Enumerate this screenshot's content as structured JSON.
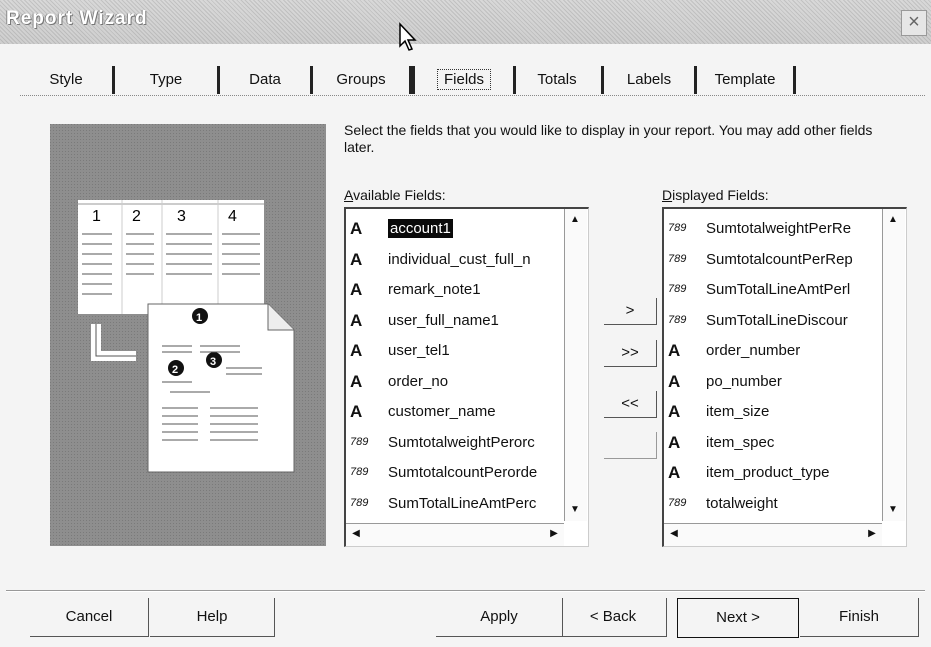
{
  "window": {
    "title": "Report Wizard",
    "close_glyph": "×"
  },
  "tabs": [
    {
      "label": "Style"
    },
    {
      "label": "Type"
    },
    {
      "label": "Data"
    },
    {
      "label": "Groups"
    },
    {
      "label": "Fields",
      "active": true
    },
    {
      "label": "Totals"
    },
    {
      "label": "Labels"
    },
    {
      "label": "Template"
    }
  ],
  "instructions": "Select the fields that you would like to display in your report. You may add other fields later.",
  "available": {
    "label_prefix": "A",
    "label_rest": "vailable Fields:",
    "items": [
      {
        "icon": "text-field-icon",
        "label": "account1",
        "selected": true
      },
      {
        "icon": "text-field-icon",
        "label": "individual_cust_full_n"
      },
      {
        "icon": "text-field-icon",
        "label": "remark_note1"
      },
      {
        "icon": "text-field-icon",
        "label": "user_full_name1"
      },
      {
        "icon": "text-field-icon",
        "label": "user_tel1"
      },
      {
        "icon": "text-field-icon",
        "label": "order_no"
      },
      {
        "icon": "text-field-icon",
        "label": "customer_name"
      },
      {
        "icon": "number-field-icon",
        "label": "SumtotalweightPerorc"
      },
      {
        "icon": "number-field-icon",
        "label": "SumtotalcountPerorde"
      },
      {
        "icon": "number-field-icon",
        "label": "SumTotalLineAmtPerc"
      }
    ]
  },
  "displayed": {
    "label_prefix": "D",
    "label_rest": "isplayed Fields:",
    "items": [
      {
        "icon": "number-field-icon",
        "label": "SumtotalweightPerRe"
      },
      {
        "icon": "number-field-icon",
        "label": "SumtotalcountPerRep"
      },
      {
        "icon": "number-field-icon",
        "label": "SumTotalLineAmtPerl"
      },
      {
        "icon": "number-field-icon",
        "label": "SumTotalLineDiscour"
      },
      {
        "icon": "text-field-icon",
        "label": "order_number"
      },
      {
        "icon": "text-field-icon",
        "label": "po_number"
      },
      {
        "icon": "text-field-icon",
        "label": "item_size"
      },
      {
        "icon": "text-field-icon",
        "label": "item_spec"
      },
      {
        "icon": "text-field-icon",
        "label": "item_product_type"
      },
      {
        "icon": "number-field-icon",
        "label": "totalweight"
      }
    ]
  },
  "icon_glyphs": {
    "text": "A",
    "number": "789"
  },
  "move_buttons": {
    "add": ">",
    "add_all": ">>",
    "remove_all": "<<",
    "remove": "<"
  },
  "buttons": {
    "cancel": "Cancel",
    "help": "Help",
    "apply": "Apply",
    "back": "< Back",
    "next": "Next >",
    "finish": "Finish"
  },
  "preview_labels": {
    "columns": [
      "1",
      "2",
      "3",
      "4"
    ],
    "markers": [
      "1",
      "2",
      "3"
    ]
  }
}
